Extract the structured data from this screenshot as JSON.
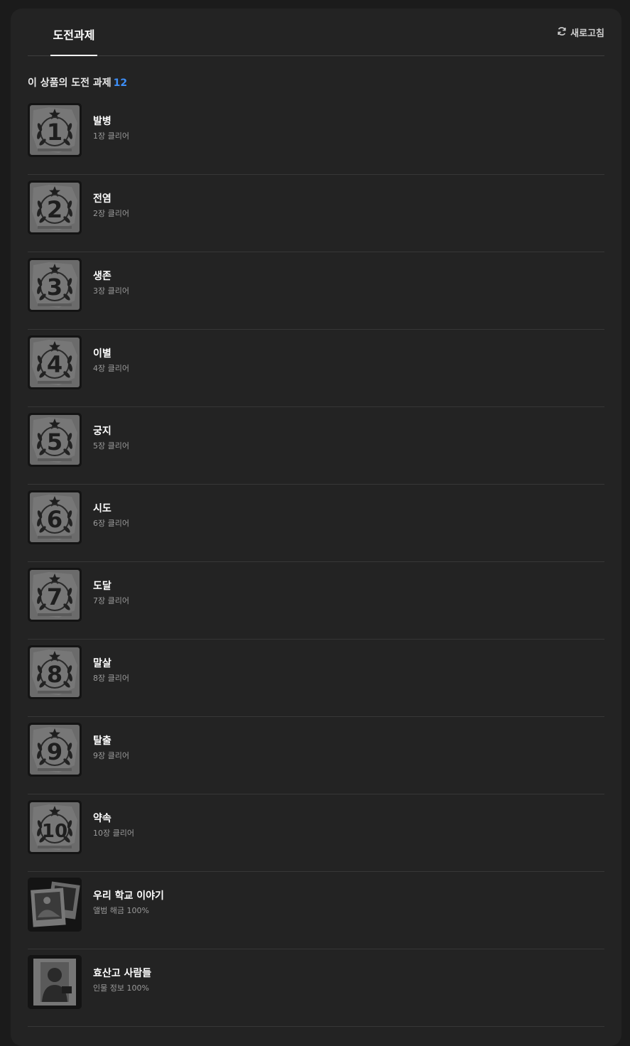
{
  "tabs": [
    {
      "label": "도전과제",
      "active": true
    }
  ],
  "refresh": {
    "label": "새로고침",
    "icon": "refresh-icon"
  },
  "section": {
    "title": "이 상품의 도전 과제",
    "count": "12"
  },
  "colors": {
    "accent": "#3d8ef7",
    "background": "#232323",
    "page": "#1b1b1b"
  },
  "achievements": [
    {
      "title": "발병",
      "subtitle": "1장 클리어",
      "icon": "laurel-number-badge-icon",
      "badge_number": "1"
    },
    {
      "title": "전염",
      "subtitle": "2장 클리어",
      "icon": "laurel-number-badge-icon",
      "badge_number": "2"
    },
    {
      "title": "생존",
      "subtitle": "3장 클리어",
      "icon": "laurel-number-badge-icon",
      "badge_number": "3"
    },
    {
      "title": "이별",
      "subtitle": "4장 클리어",
      "icon": "laurel-number-badge-icon",
      "badge_number": "4"
    },
    {
      "title": "궁지",
      "subtitle": "5장 클리어",
      "icon": "laurel-number-badge-icon",
      "badge_number": "5"
    },
    {
      "title": "시도",
      "subtitle": "6장 클리어",
      "icon": "laurel-number-badge-icon",
      "badge_number": "6"
    },
    {
      "title": "도달",
      "subtitle": "7장 클리어",
      "icon": "laurel-number-badge-icon",
      "badge_number": "7"
    },
    {
      "title": "말살",
      "subtitle": "8장 클리어",
      "icon": "laurel-number-badge-icon",
      "badge_number": "8"
    },
    {
      "title": "탈출",
      "subtitle": "9장 클리어",
      "icon": "laurel-number-badge-icon",
      "badge_number": "9"
    },
    {
      "title": "약속",
      "subtitle": "10장 클리어",
      "icon": "laurel-number-badge-icon",
      "badge_number": "10"
    },
    {
      "title": "우리 학교 이야기",
      "subtitle": "앨범 해금 100%",
      "icon": "photo-album-icon",
      "badge_number": ""
    },
    {
      "title": "효산고 사람들",
      "subtitle": "인물 정보 100%",
      "icon": "character-profile-icon",
      "badge_number": ""
    }
  ]
}
